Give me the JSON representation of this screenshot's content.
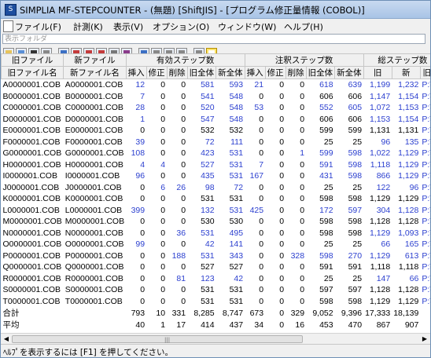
{
  "window": {
    "title": "SIMPLIA MF-STEPCOUNTER - (無題) [ShiftJIS] - [プログラム修正量情報 (COBOL)]"
  },
  "menu": [
    "ファイル(F)",
    "計測(K)",
    "表示(V)",
    "オプション(O)",
    "ウィンドウ(W)",
    "ヘルプ(H)"
  ],
  "path_bar": {
    "placeholder": "表示フォルダ"
  },
  "toolbar": {
    "icons": [
      "open-folder-icon",
      "open-file-icon",
      "save-icon",
      "print-icon",
      "copy-icon",
      "step-count-icon",
      "compare-icon",
      "export-icon",
      "settings-icon",
      "book-icon",
      "window-icon",
      "compare-wide-icon",
      "range-icon",
      "range-alt-icon",
      "flag-icon",
      "document-icon"
    ]
  },
  "table": {
    "group_headers": [
      "旧ファイル",
      "新ファイル",
      "有効ステップ数",
      "注釈ステップ数",
      "総ステップ数"
    ],
    "columns": [
      "旧ファイル名",
      "新ファイル名",
      "挿入",
      "修正",
      "削除",
      "旧全体",
      "新全体",
      "挿入",
      "修正",
      "削除",
      "旧全体",
      "新全体",
      "旧",
      "新",
      "旧パ"
    ],
    "rows": [
      [
        "A0000001.COB",
        "A0000001.COB",
        "12",
        "0",
        "0",
        "581",
        "593",
        "21",
        "0",
        "0",
        "618",
        "639",
        "1,199",
        "1,232",
        "P:¥H"
      ],
      [
        "B0000001.COB",
        "B0000001.COB",
        "7",
        "0",
        "0",
        "541",
        "548",
        "0",
        "0",
        "0",
        "606",
        "606",
        "1,147",
        "1,154",
        "P:¥H"
      ],
      [
        "C0000001.COB",
        "C0000001.COB",
        "28",
        "0",
        "0",
        "520",
        "548",
        "53",
        "0",
        "0",
        "552",
        "605",
        "1,072",
        "1,153",
        "P:¥H"
      ],
      [
        "D0000001.COB",
        "D0000001.COB",
        "1",
        "0",
        "0",
        "547",
        "548",
        "0",
        "0",
        "0",
        "606",
        "606",
        "1,153",
        "1,154",
        "P:¥H"
      ],
      [
        "E0000001.COB",
        "E0000001.COB",
        "0",
        "0",
        "0",
        "532",
        "532",
        "0",
        "0",
        "0",
        "599",
        "599",
        "1,131",
        "1,131",
        "P:¥H"
      ],
      [
        "F0000001.COB",
        "F0000001.COB",
        "39",
        "0",
        "0",
        "72",
        "111",
        "0",
        "0",
        "0",
        "25",
        "25",
        "96",
        "135",
        "P:¥H"
      ],
      [
        "G0000001.COB",
        "G0000001.COB",
        "108",
        "0",
        "0",
        "423",
        "531",
        "0",
        "0",
        "1",
        "599",
        "598",
        "1,022",
        "1,129",
        "P:¥H"
      ],
      [
        "H0000001.COB",
        "H0000001.COB",
        "4",
        "4",
        "0",
        "527",
        "531",
        "7",
        "0",
        "0",
        "591",
        "598",
        "1,118",
        "1,129",
        "P:¥H"
      ],
      [
        "I0000001.COB",
        "I0000001.COB",
        "96",
        "0",
        "0",
        "435",
        "531",
        "167",
        "0",
        "0",
        "431",
        "598",
        "866",
        "1,129",
        "P:¥H"
      ],
      [
        "J0000001.COB",
        "J0000001.COB",
        "0",
        "6",
        "26",
        "98",
        "72",
        "0",
        "0",
        "0",
        "25",
        "25",
        "122",
        "96",
        "P:¥H"
      ],
      [
        "K0000001.COB",
        "K0000001.COB",
        "0",
        "0",
        "0",
        "531",
        "531",
        "0",
        "0",
        "0",
        "598",
        "598",
        "1,129",
        "1,129",
        "P:¥H"
      ],
      [
        "L0000001.COB",
        "L0000001.COB",
        "399",
        "0",
        "0",
        "132",
        "531",
        "425",
        "0",
        "0",
        "172",
        "597",
        "304",
        "1,128",
        "P:¥H"
      ],
      [
        "M0000001.COB",
        "M0000001.COB",
        "0",
        "0",
        "0",
        "530",
        "530",
        "0",
        "0",
        "0",
        "598",
        "598",
        "1,128",
        "1,128",
        "P:¥H"
      ],
      [
        "N0000001.COB",
        "N0000001.COB",
        "0",
        "0",
        "36",
        "531",
        "495",
        "0",
        "0",
        "0",
        "598",
        "598",
        "1,129",
        "1,093",
        "P:¥H"
      ],
      [
        "O0000001.COB",
        "O0000001.COB",
        "99",
        "0",
        "0",
        "42",
        "141",
        "0",
        "0",
        "0",
        "25",
        "25",
        "66",
        "165",
        "P:¥H"
      ],
      [
        "P0000001.COB",
        "P0000001.COB",
        "0",
        "0",
        "188",
        "531",
        "343",
        "0",
        "0",
        "328",
        "598",
        "270",
        "1,129",
        "613",
        "P:¥H"
      ],
      [
        "Q0000001.COB",
        "Q0000001.COB",
        "0",
        "0",
        "0",
        "527",
        "527",
        "0",
        "0",
        "0",
        "591",
        "591",
        "1,118",
        "1,118",
        "P:¥H"
      ],
      [
        "R0000001.COB",
        "R0000001.COB",
        "0",
        "0",
        "81",
        "123",
        "42",
        "0",
        "0",
        "0",
        "25",
        "25",
        "147",
        "66",
        "P:¥H"
      ],
      [
        "S0000001.COB",
        "S0000001.COB",
        "0",
        "0",
        "0",
        "531",
        "531",
        "0",
        "0",
        "0",
        "597",
        "597",
        "1,128",
        "1,128",
        "P:¥H"
      ],
      [
        "T0000001.COB",
        "T0000001.COB",
        "0",
        "0",
        "0",
        "531",
        "531",
        "0",
        "0",
        "0",
        "598",
        "598",
        "1,129",
        "1,129",
        "P:¥H"
      ]
    ],
    "summary": [
      [
        "合計",
        "",
        "793",
        "10",
        "331",
        "8,285",
        "8,747",
        "673",
        "0",
        "329",
        "9,052",
        "9,396",
        "17,333",
        "18,139",
        ""
      ],
      [
        "平均",
        "",
        "40",
        "1",
        "17",
        "414",
        "437",
        "34",
        "0",
        "16",
        "453",
        "470",
        "867",
        "907",
        ""
      ]
    ]
  },
  "status": {
    "text": "ﾍﾙﾌﾟを表示するには [F1] を押してください。"
  },
  "colors": {
    "changed_value": "#2b3fcf",
    "path_text": "#2b3fcf"
  }
}
